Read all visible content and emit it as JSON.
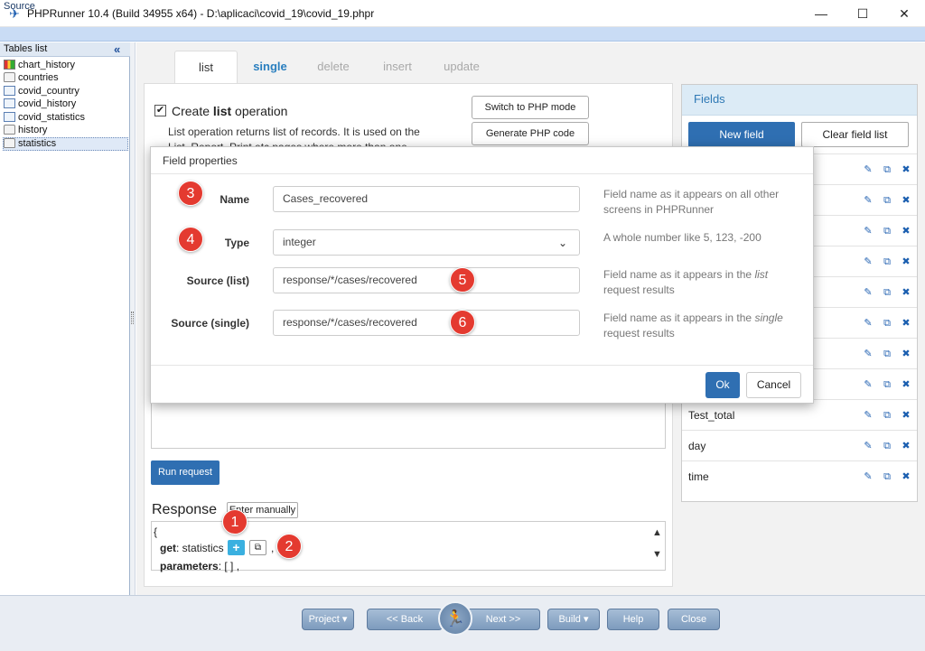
{
  "window": {
    "title": "PHPRunner 10.4 (Build 34955 x64) - D:\\aplicaci\\covid_19\\covid_19.phpr",
    "minimize": "—",
    "maximize": "☐",
    "close": "✕"
  },
  "source_bar": {
    "label": "Source"
  },
  "tables_list": {
    "title": "Tables list",
    "collapse": "«",
    "items": [
      {
        "label": "chart_history"
      },
      {
        "label": "countries"
      },
      {
        "label": "covid_country"
      },
      {
        "label": "covid_history"
      },
      {
        "label": "covid_statistics"
      },
      {
        "label": "history"
      },
      {
        "label": "statistics"
      }
    ]
  },
  "tabs": [
    {
      "label": "list"
    },
    {
      "label": "single"
    },
    {
      "label": "delete"
    },
    {
      "label": "insert"
    },
    {
      "label": "update"
    }
  ],
  "editor": {
    "create_prefix": "Create ",
    "create_bold": "list",
    "create_suffix": " operation",
    "description": "List operation returns list of records. It is used on the List, Report, Print etc pages where more than one record can be",
    "switch_php": "Switch to PHP mode",
    "generate_php": "Generate PHP code",
    "run_request": "Run request",
    "response_label": "Response",
    "enter_manually": "Enter manually",
    "code": {
      "open_brace": "{",
      "get_key": "get",
      "get_value": ": statistics",
      "params_key": "parameters",
      "params_value": ": [ ] ,",
      "comma": ","
    }
  },
  "fields_panel": {
    "title": "Fields",
    "new_field": "New field",
    "clear_field_list": "Clear field list",
    "rows": [
      {
        "name": ""
      },
      {
        "name": ""
      },
      {
        "name": ""
      },
      {
        "name": ""
      },
      {
        "name": ""
      },
      {
        "name": ""
      },
      {
        "name": ""
      },
      {
        "name": ""
      },
      {
        "name": "Test_total"
      },
      {
        "name": "day"
      },
      {
        "name": "time"
      }
    ]
  },
  "field_properties": {
    "title": "Field properties",
    "name_label": "Name",
    "name_value": "Cases_recovered",
    "name_help": "Field name as it appears on all other screens in PHPRunner",
    "type_label": "Type",
    "type_value": "integer",
    "type_help": "A whole number like 5, 123, -200",
    "source_list_label": "Source (list)",
    "source_list_value": "response/*/cases/recovered",
    "source_list_help_pre": "Field name as it appears in the ",
    "source_list_help_em": "list",
    "source_list_help_post": " request results",
    "source_single_label": "Source (single)",
    "source_single_value": "response/*/cases/recovered",
    "source_single_help_pre": "Field name as it appears in the ",
    "source_single_help_em": "single",
    "source_single_help_post": " request results",
    "ok": "Ok",
    "cancel": "Cancel"
  },
  "badges": [
    "1",
    "2",
    "3",
    "4",
    "5",
    "6"
  ],
  "bottom_nav": {
    "project": "Project ▾",
    "back": "<< Back",
    "next": "Next >>",
    "build": "Build ▾",
    "help": "Help",
    "close": "Close"
  },
  "icons": {
    "edit": "edit-icon",
    "copy": "copy-icon",
    "delete": "delete-icon"
  }
}
